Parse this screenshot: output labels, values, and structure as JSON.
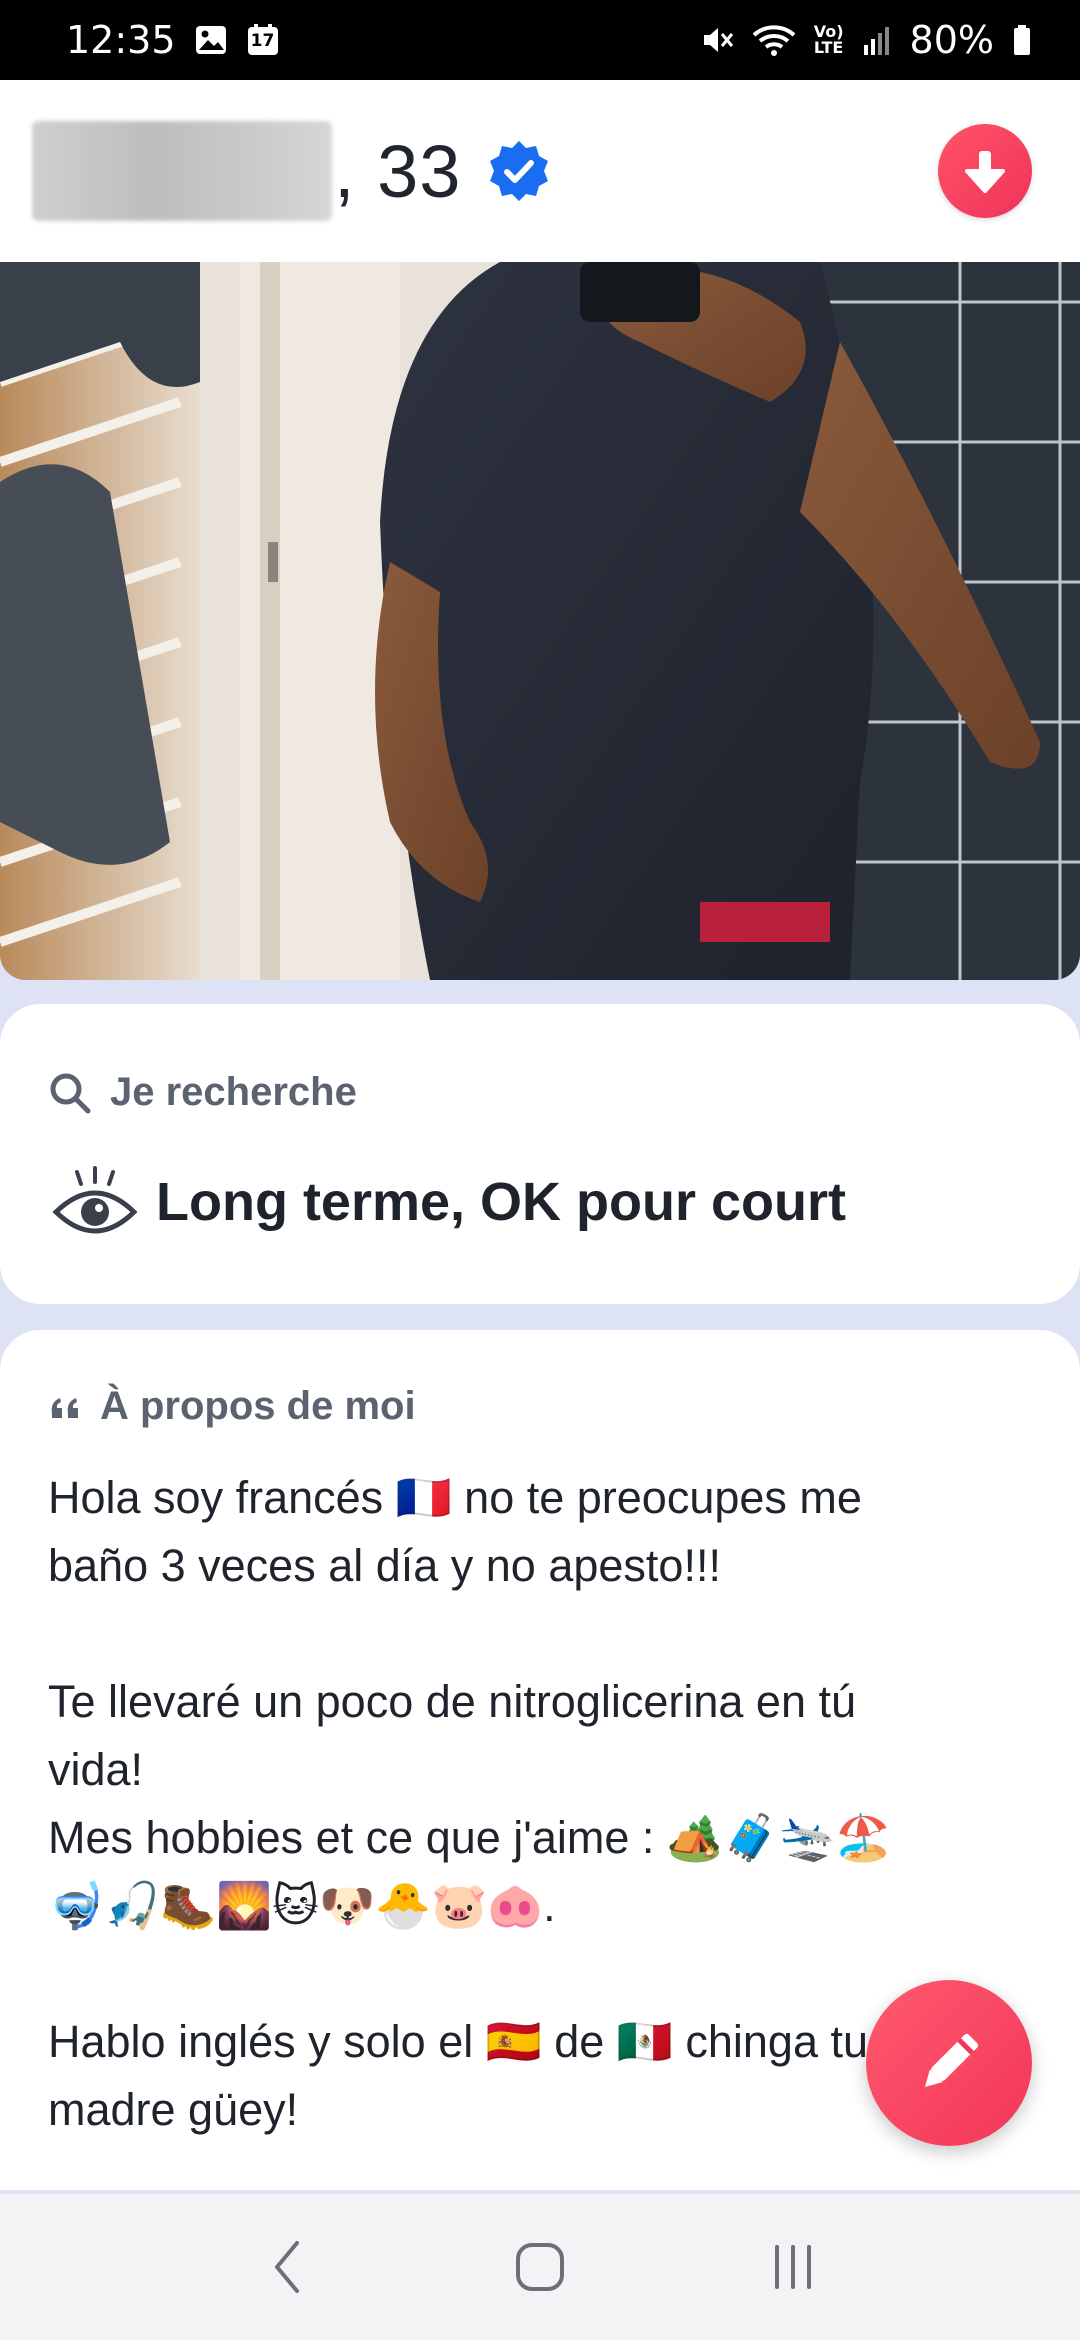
{
  "status_bar": {
    "time": "12:35",
    "left_icons": [
      "image-icon",
      "calendar-icon"
    ],
    "calendar_day": "17",
    "right_icons": [
      "mute-icon",
      "wifi-icon",
      "volte-icon",
      "signal-icon",
      "battery-icon"
    ],
    "volte_top": "Vo)",
    "volte_bottom": "LTE",
    "battery": "80%"
  },
  "profile": {
    "name_age": ", 33",
    "verified": true,
    "accent_color": "#f2355a",
    "verified_color": "#1a6cf0"
  },
  "looking_for": {
    "label": "Je recherche",
    "value": "Long terme, OK pour court"
  },
  "about": {
    "label": "À propos de moi",
    "text": "Hola soy francés 🇫🇷 no te preocupes me\nbaño 3 veces al día y no apesto!!!\n\nTe llevaré un poco de nitroglicerina en tú\nvida!\nMes hobbies et ce que j'aime : 🏕️🧳🛬🏖️\n🤿🎣🥾🌄🐱🐶🐣🐷🐽.\n\nHablo inglés y solo el 🇪🇸 de 🇲🇽 chinga tu\nmadre güey!"
  },
  "nav": {
    "buttons": [
      "back-icon",
      "home-icon",
      "recents-icon"
    ]
  }
}
